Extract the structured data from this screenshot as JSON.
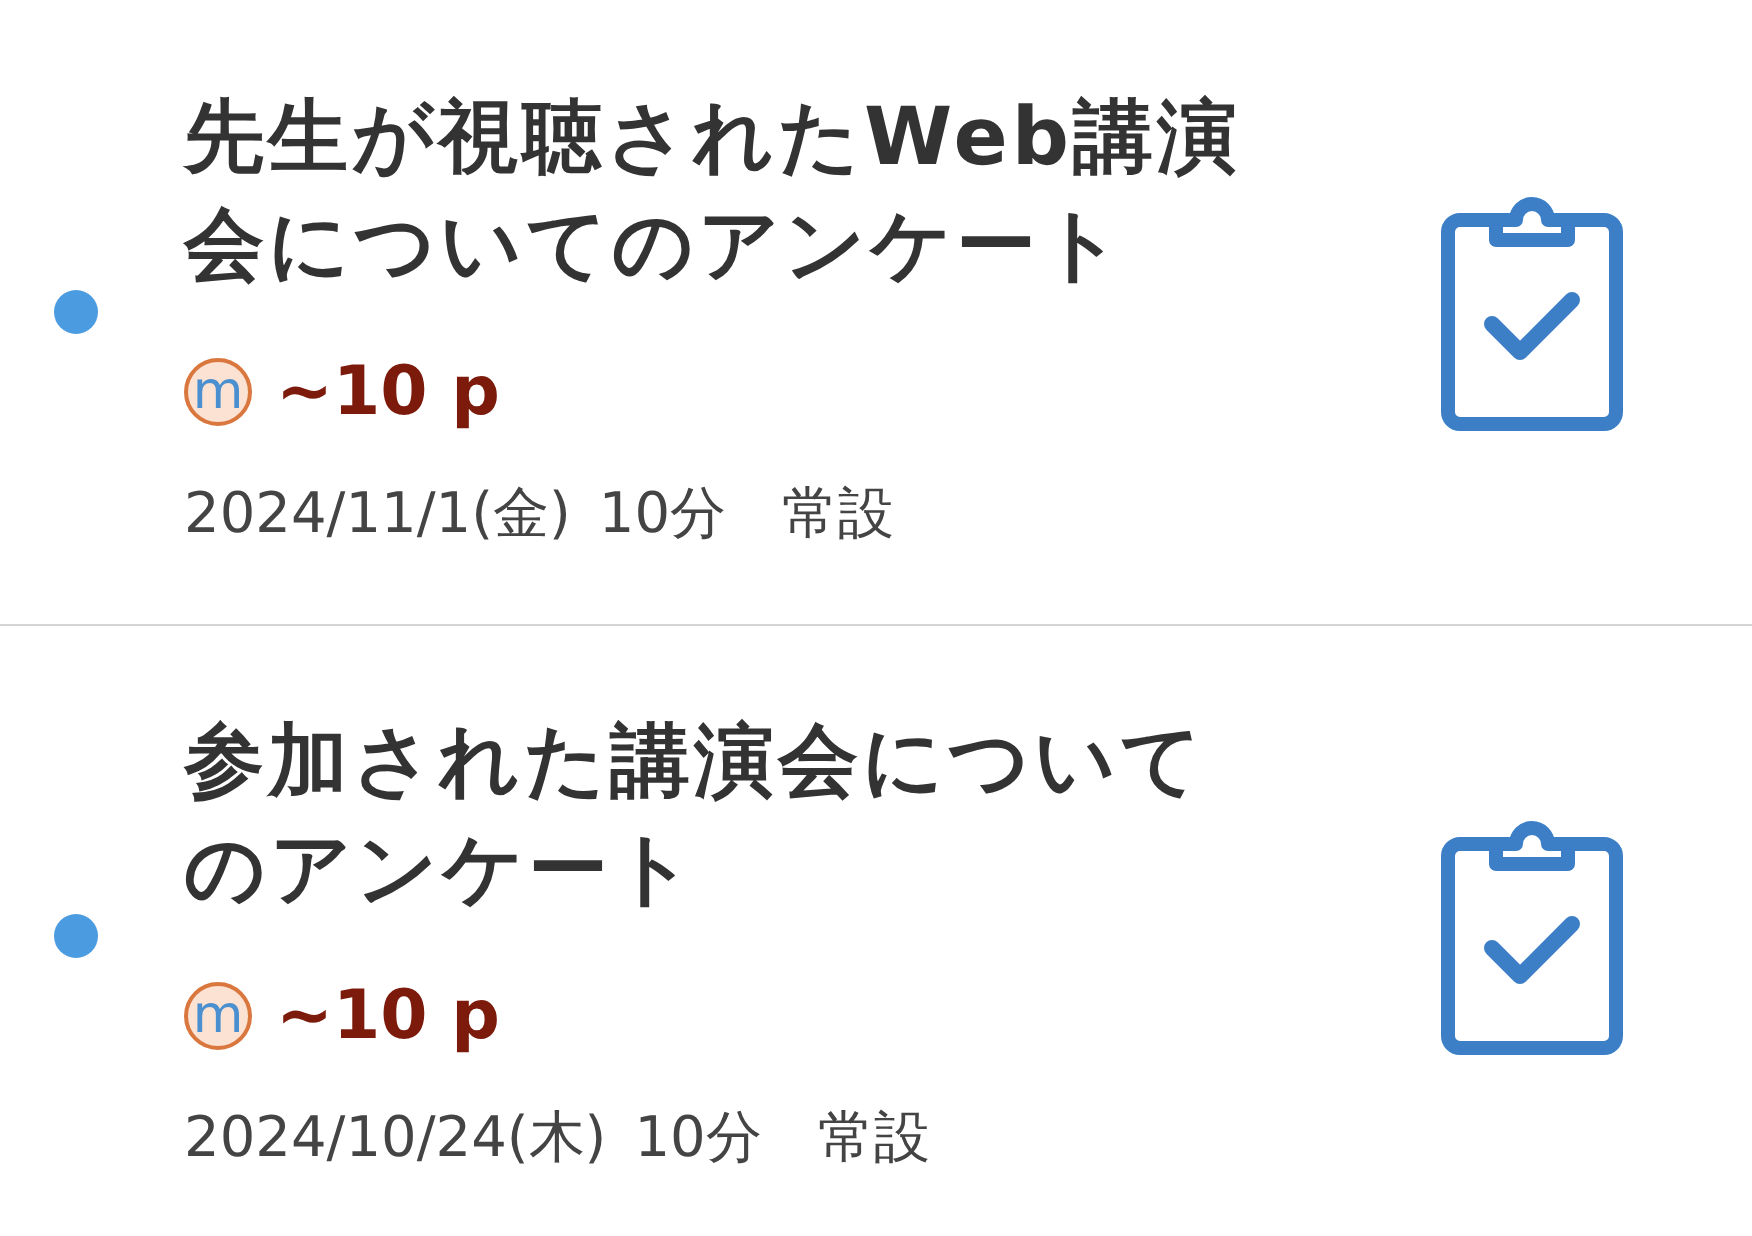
{
  "items": [
    {
      "title": "先生が視聴されたWeb講演会についてのアンケート",
      "unread": true,
      "points": "~10 p",
      "point_icon": "m",
      "date": "2024/11/1(金)",
      "duration": "10分",
      "category": "常設"
    },
    {
      "title": "参加された講演会についてのアンケート",
      "unread": true,
      "points": "~10 p",
      "point_icon": "m",
      "date": "2024/10/24(木)",
      "duration": "10分",
      "category": "常設"
    }
  ]
}
